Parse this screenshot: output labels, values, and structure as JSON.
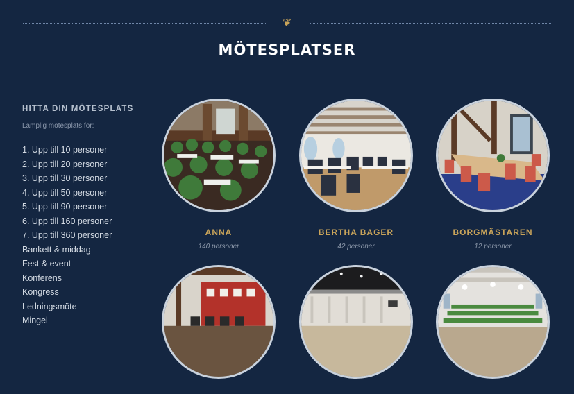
{
  "title": "MÖTESPLATSER",
  "sidebar": {
    "heading": "HITTA DIN MÖTESPLATS",
    "subheading": "Lämplig mötesplats för:",
    "items": [
      "1. Upp till 10 personer",
      "2. Upp till 20 personer",
      "3. Upp till 30 personer",
      "4. Upp till 50 personer",
      "5. Upp till 90 personer",
      "6. Upp till 160 personer",
      "7. Upp till 360 personer",
      "Bankett & middag",
      "Fest & event",
      "Konferens",
      "Kongress",
      "Ledningsmöte",
      "Mingel"
    ]
  },
  "venues": [
    {
      "name": "ANNA",
      "capacity": "140 personer"
    },
    {
      "name": "BERTHA BAGER",
      "capacity": "42 personer"
    },
    {
      "name": "BORGMÄSTAREN",
      "capacity": "12 personer"
    },
    {
      "name": "",
      "capacity": ""
    },
    {
      "name": "",
      "capacity": ""
    },
    {
      "name": "",
      "capacity": ""
    }
  ],
  "colors": {
    "background": "#142641",
    "accent": "#c9a45a",
    "title": "#ffffff"
  },
  "ornament_icon": "fleuron-icon"
}
